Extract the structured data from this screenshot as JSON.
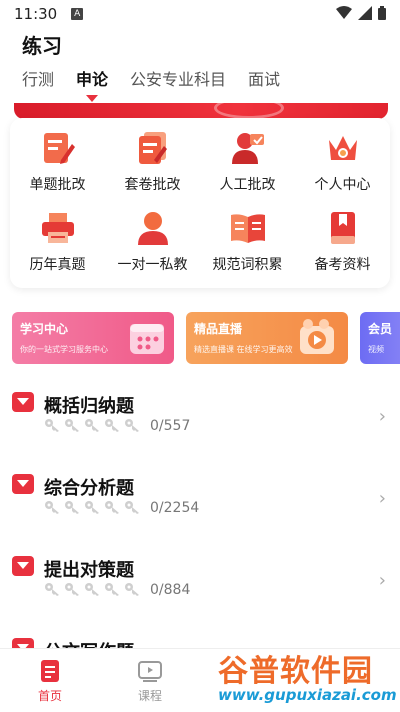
{
  "status": {
    "time": "11:30",
    "badge": "A"
  },
  "header": {
    "title": "练习"
  },
  "tabs": [
    {
      "label": "行测",
      "active": false
    },
    {
      "label": "申论",
      "active": true
    },
    {
      "label": "公安专业科目",
      "active": false
    },
    {
      "label": "面试",
      "active": false
    }
  ],
  "grid": [
    {
      "label": "单题批改",
      "icon": "edit-sheet-icon"
    },
    {
      "label": "套卷批改",
      "icon": "paper-stack-icon"
    },
    {
      "label": "人工批改",
      "icon": "teacher-icon"
    },
    {
      "label": "个人中心",
      "icon": "crown-icon"
    },
    {
      "label": "历年真题",
      "icon": "printer-icon"
    },
    {
      "label": "一对一私教",
      "icon": "person-icon"
    },
    {
      "label": "规范词积累",
      "icon": "open-book-icon"
    },
    {
      "label": "备考资料",
      "icon": "material-book-icon"
    }
  ],
  "promos": [
    {
      "title": "学习中心",
      "subtitle": "你的一站式学习服务中心"
    },
    {
      "title": "精品直播",
      "subtitle": "精选直播课 在线学习更高效"
    },
    {
      "title": "会员",
      "subtitle": "视频"
    }
  ],
  "list": [
    {
      "title": "概括归纳题",
      "count": "0/557"
    },
    {
      "title": "综合分析题",
      "count": "0/2254"
    },
    {
      "title": "提出对策题",
      "count": "0/884"
    },
    {
      "title": "公文写作题",
      "count": ""
    }
  ],
  "bottom_nav": [
    {
      "label": "首页",
      "active": true
    },
    {
      "label": "课程",
      "active": false
    }
  ],
  "watermark": {
    "top": "谷普软件园",
    "bottom": "www.gupuxiazai.com"
  },
  "colors": {
    "accent": "#e8313e",
    "promo1": "#f05a88",
    "promo2": "#f48a45",
    "promo3": "#7a78f4"
  }
}
